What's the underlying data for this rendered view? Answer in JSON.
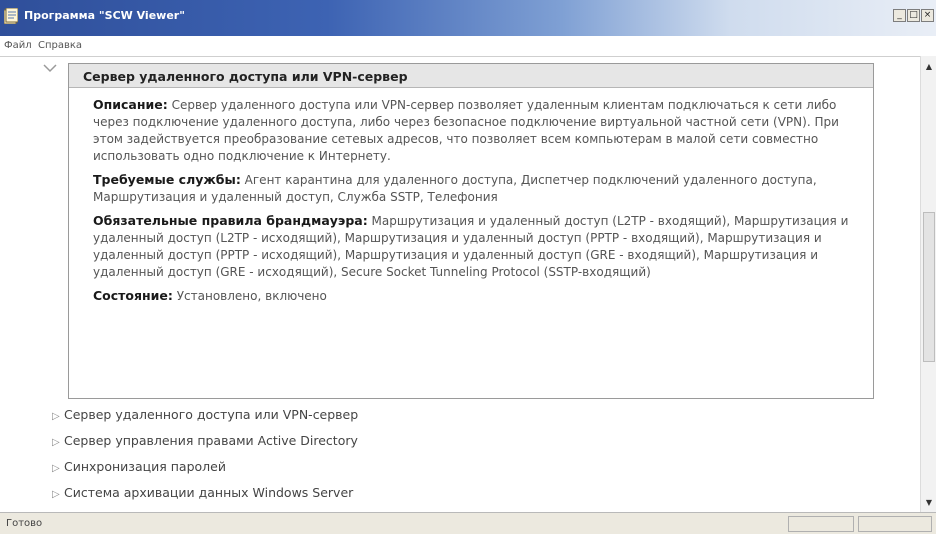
{
  "window": {
    "title": "Программа \"SCW Viewer\"",
    "controls": {
      "minimize": "_",
      "maximize": "□",
      "close": "×"
    }
  },
  "menu": {
    "file": "Файл",
    "help": "Справка"
  },
  "expanded_item": {
    "title": "Сервер удаленного доступа или VPN-сервер",
    "description_label": "Описание:",
    "description_text": "Сервер удаленного доступа или VPN-сервер позволяет удаленным клиентам подключаться к сети либо через подключение удаленного доступа, либо через безопасное подключение виртуальной частной сети (VPN). При этом задействуется преобразование сетевых адресов, что позволяет всем компьютерам в малой сети совместно использовать одно подключение к Интернету.",
    "services_label": "Требуемые службы:",
    "services_text": "Агент карантина для удаленного доступа, Диспетчер подключений удаленного доступа, Маршрутизация и удаленный доступ, Служба SSTP, Телефония",
    "firewall_label": "Обязательные правила брандмауэра:",
    "firewall_text": "Маршрутизация и удаленный доступ (L2TP - входящий), Маршрутизация и удаленный доступ (L2TP - исходящий), Маршрутизация и удаленный доступ (PPTP - входящий), Маршрутизация и удаленный доступ (PPTP - исходящий), Маршрутизация и удаленный доступ (GRE - входящий), Маршрутизация и удаленный доступ (GRE - исходящий), Secure Socket Tunneling Protocol (SSTP-входящий)",
    "status_label": "Состояние:",
    "status_text": "Установлено, включено"
  },
  "tree_items": [
    "Сервер удаленного доступа или VPN-сервер",
    "Сервер управления правами Active Directory",
    "Синхронизация паролей",
    "Система архивации данных Windows Server"
  ],
  "status_bar": {
    "text": "Готово"
  },
  "colors": {
    "title_gradient_start": "#2f4f9a",
    "header_bg": "#e6e6e6",
    "chrome_bg": "#ece9df"
  }
}
